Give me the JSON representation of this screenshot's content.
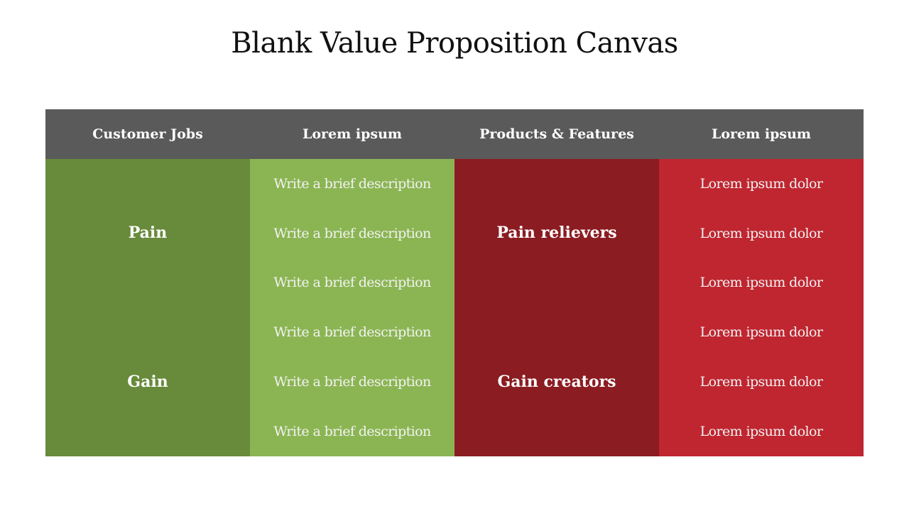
{
  "title": "Blank Value Proposition Canvas",
  "header": [
    "Customer Jobs",
    "Lorem ipsum",
    "Products & Features",
    "Lorem ipsum"
  ],
  "columns": {
    "customer_jobs": [
      "Pain",
      "Gain"
    ],
    "descriptions": [
      "Write a brief description",
      "Write a brief description",
      "Write a brief description",
      "Write a brief description",
      "Write a brief description",
      "Write a brief description"
    ],
    "products_features": [
      "Pain relievers",
      "Gain creators"
    ],
    "lorem": [
      "Lorem ipsum dolor",
      "Lorem ipsum dolor",
      "Lorem ipsum dolor",
      "Lorem ipsum dolor",
      "Lorem ipsum dolor",
      "Lorem ipsum dolor"
    ]
  },
  "colors": {
    "header": "#5a5a5a",
    "dark_green": "#688a3b",
    "light_green": "#8bb553",
    "dark_red": "#8b1c22",
    "red": "#bf2630"
  }
}
